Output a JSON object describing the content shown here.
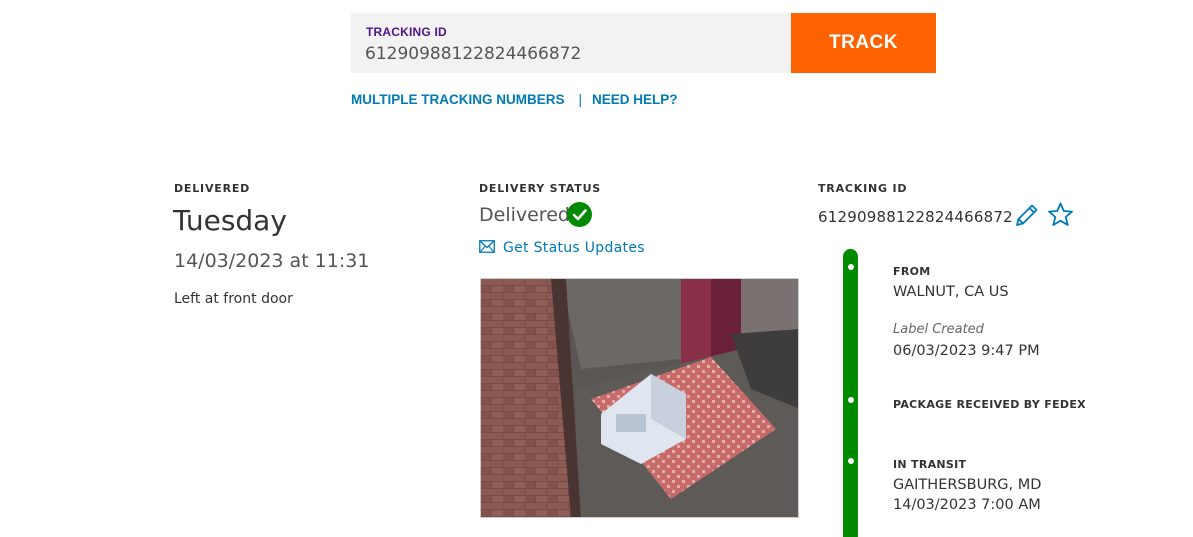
{
  "search": {
    "label": "TRACKING ID",
    "value": "61290988122824466872",
    "button": "TRACK"
  },
  "links": {
    "multiple": "MULTIPLE TRACKING NUMBERS",
    "separator": "|",
    "help": "NEED HELP?"
  },
  "delivered": {
    "header": "DELIVERED",
    "day": "Tuesday",
    "datetime": "14/03/2023 at 11:31",
    "note": "Left at front door"
  },
  "status": {
    "header": "DELIVERY STATUS",
    "value": "Delivered",
    "updates_link": "Get Status Updates",
    "icons": {
      "check": "check-circle-icon",
      "mail": "envelope-icon"
    }
  },
  "tracking": {
    "header": "TRACKING ID",
    "value": "61290988122824466872",
    "icons": {
      "edit": "pencil-icon",
      "favorite": "star-icon"
    }
  },
  "timeline": [
    {
      "header": "FROM",
      "location": "WALNUT, CA US",
      "event": "Label Created",
      "datetime": "06/03/2023 9:47 PM"
    },
    {
      "header": "PACKAGE RECEIVED BY FEDEX"
    },
    {
      "header": "IN TRANSIT",
      "location": "GAITHERSBURG, MD",
      "datetime": "14/03/2023 7:00 AM"
    }
  ],
  "colors": {
    "accent_orange": "#ff6200",
    "brand_purple": "#4d148c",
    "link_blue": "#007ab7",
    "success_green": "#008a00"
  }
}
